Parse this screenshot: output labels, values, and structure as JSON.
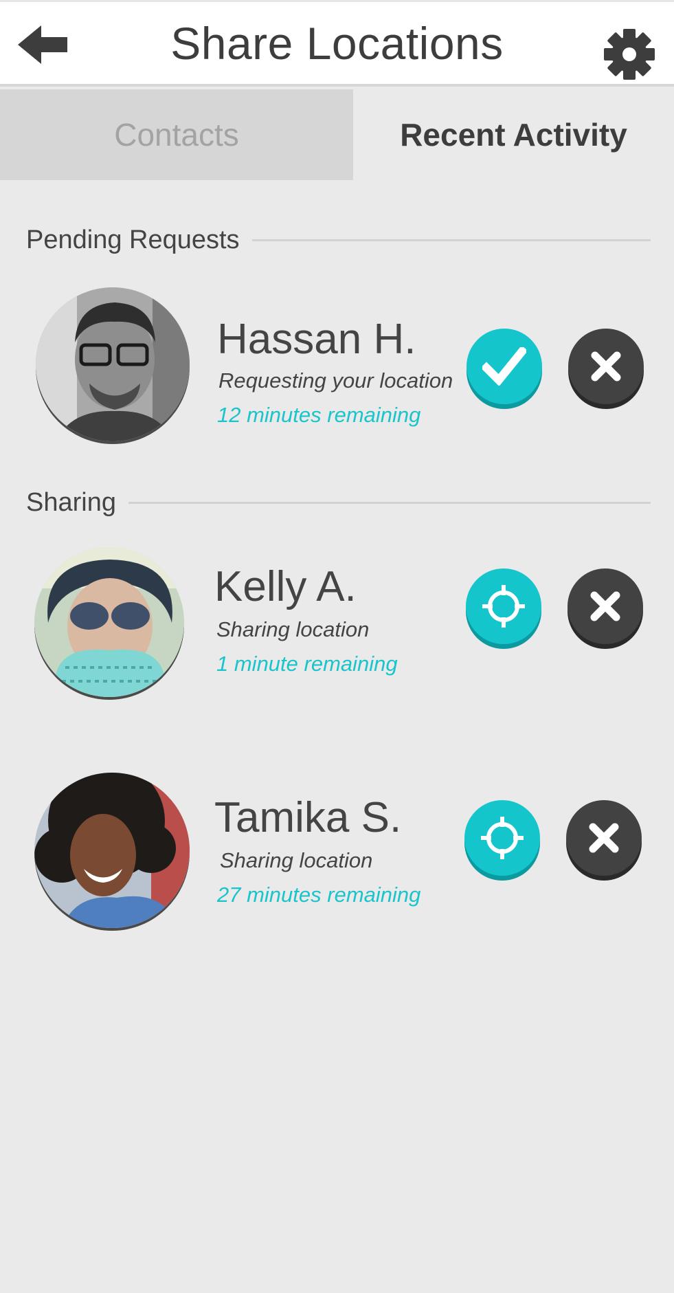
{
  "header": {
    "title": "Share Locations",
    "back_icon": "arrow-left-icon",
    "settings_icon": "gear-icon"
  },
  "tabs": [
    {
      "label": "Contacts",
      "active": false
    },
    {
      "label": "Recent Activity",
      "active": true
    }
  ],
  "colors": {
    "accent": "#14c6cc",
    "decline": "#424242",
    "background": "#eaeaea",
    "inactive_tab": "#d6d6d6"
  },
  "pending": {
    "heading": "Pending Requests",
    "items": [
      {
        "name": "Hassan H.",
        "status": "Requesting your location",
        "remaining": "12 minutes remaining",
        "accept_icon": "check-icon",
        "decline_icon": "close-icon"
      }
    ]
  },
  "sharing": {
    "heading": "Sharing",
    "items": [
      {
        "name": "Kelly A.",
        "status": "Sharing location",
        "remaining": "1 minute remaining",
        "locate_icon": "crosshair-icon",
        "stop_icon": "close-icon"
      },
      {
        "name": "Tamika S.",
        "status": "Sharing location",
        "remaining": "27 minutes remaining",
        "locate_icon": "crosshair-icon",
        "stop_icon": "close-icon"
      }
    ]
  }
}
